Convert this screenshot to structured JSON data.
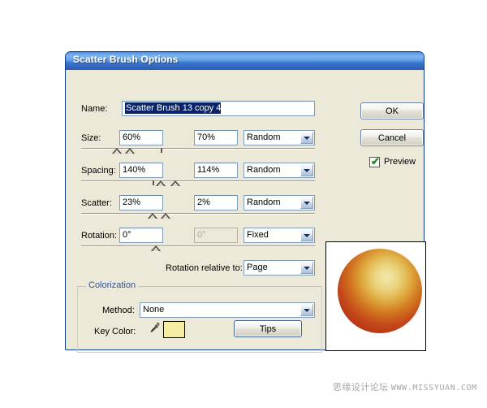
{
  "window": {
    "title": "Scatter Brush Options"
  },
  "fields": {
    "name_label": "Name:",
    "name_value": "Scatter Brush 13 copy 4"
  },
  "rows": [
    {
      "label": "Size:",
      "value1": "60%",
      "value2": "70%",
      "mode": "Random"
    },
    {
      "label": "Spacing:",
      "value1": "140%",
      "value2": "114%",
      "mode": "Random"
    },
    {
      "label": "Scatter:",
      "value1": "23%",
      "value2": "2%",
      "mode": "Random"
    },
    {
      "label": "Rotation:",
      "value1": "0°",
      "value2": "0°",
      "mode": "Fixed"
    }
  ],
  "rotation_relative": {
    "label": "Rotation relative to:",
    "value": "Page"
  },
  "colorization": {
    "legend": "Colorization",
    "method_label": "Method:",
    "method_value": "None",
    "key_color_label": "Key Color:",
    "key_color_hex": "#f5eda2",
    "tips_label": "Tips"
  },
  "buttons": {
    "ok": "OK",
    "cancel": "Cancel"
  },
  "preview": {
    "checkbox_label": "Preview",
    "checked": true,
    "check_glyph": "✔"
  },
  "watermark": {
    "cjk": "思缘设计论坛",
    "url": "WWW.MISSYUAN.COM"
  },
  "colors": {
    "title_start": "#7db3ee",
    "title_end": "#2a5cb4",
    "dialog_face": "#ece9d8",
    "selection": "#0a246a",
    "group_legend": "#35538f"
  }
}
